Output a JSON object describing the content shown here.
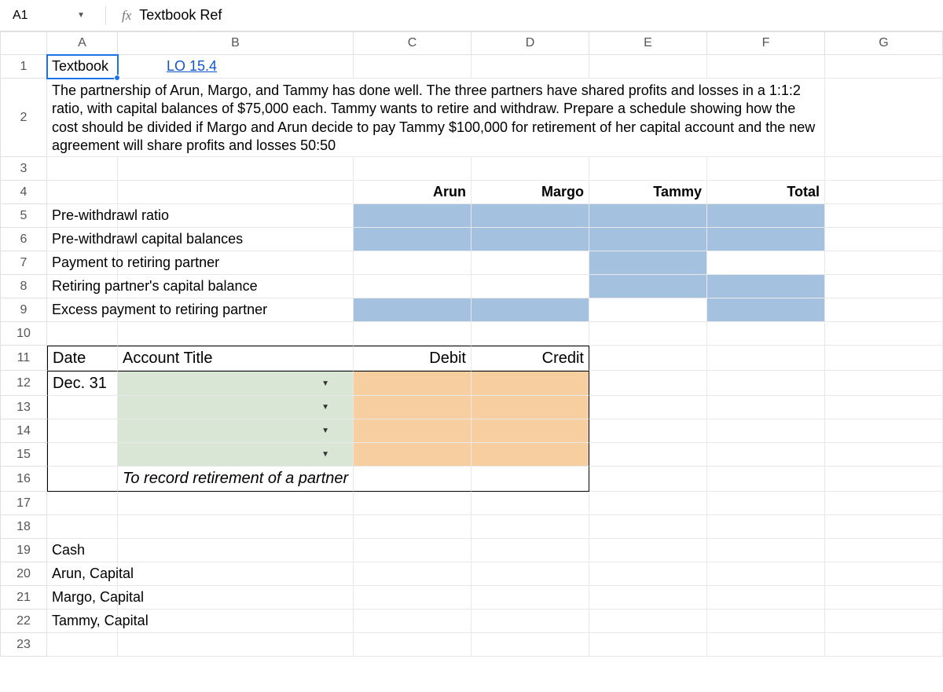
{
  "nameBox": "A1",
  "formulaContent": "Textbook Ref",
  "columns": [
    "A",
    "B",
    "C",
    "D",
    "E",
    "F",
    "G"
  ],
  "rows": {
    "1": {
      "A_text": "Textbook",
      "B_link": "LO 15.4"
    },
    "2": {
      "problem": "The partnership of Arun, Margo, and Tammy has done well. The three partners have shared profits and losses in a 1:1:2 ratio, with capital balances of $75,000 each. Tammy wants to retire and withdraw. Prepare a schedule showing how the cost should be divided if Margo and Arun decide to pay Tammy $100,000 for retirement of her capital account and the new agreement will share profits and losses 50:50"
    },
    "4": {
      "C": "Arun",
      "D": "Margo",
      "E": "Tammy",
      "F": "Total"
    },
    "5": {
      "A": "Pre-withdrawl ratio"
    },
    "6": {
      "A": "Pre-withdrawl capital balances"
    },
    "7": {
      "A": "Payment to retiring partner"
    },
    "8": {
      "A": "Retiring partner's capital balance"
    },
    "9": {
      "A": "Excess payment to retiring partner"
    },
    "11": {
      "A": "Date",
      "B": "Account Title",
      "C": "Debit",
      "D": "Credit"
    },
    "12": {
      "A": "Dec. 31"
    },
    "16": {
      "B": "To record retirement of a partner"
    },
    "19": {
      "A": "Cash"
    },
    "20": {
      "A": "Arun, Capital"
    },
    "21": {
      "A": "Margo, Capital"
    },
    "22": {
      "A": "Tammy, Capital"
    }
  }
}
